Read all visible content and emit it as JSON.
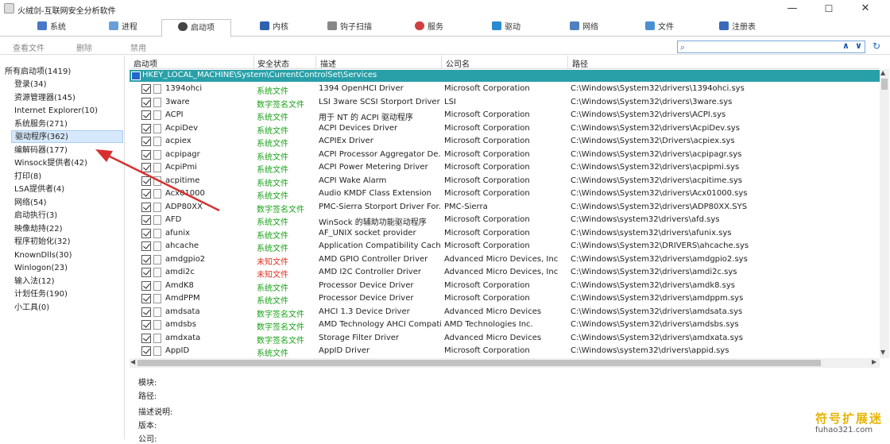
{
  "window": {
    "title": "火绒剑-互联网安全分析软件",
    "minimize": "—",
    "maximize": "☐",
    "close": "✕"
  },
  "tabs": [
    {
      "label": "系统",
      "icon": "system-icon",
      "color": "#4a78c8"
    },
    {
      "label": "进程",
      "icon": "process-icon",
      "color": "#6aa0d8"
    },
    {
      "label": "启动项",
      "icon": "startup-icon",
      "color": "#444444"
    },
    {
      "label": "内核",
      "icon": "kernel-icon",
      "color": "#3060b0"
    },
    {
      "label": "钩子扫描",
      "icon": "hook-scan-icon",
      "color": "#888888"
    },
    {
      "label": "服务",
      "icon": "service-icon",
      "color": "#d04040"
    },
    {
      "label": "驱动",
      "icon": "driver-icon",
      "color": "#2a8ad0"
    },
    {
      "label": "网络",
      "icon": "network-icon",
      "color": "#5080c0"
    },
    {
      "label": "文件",
      "icon": "file-icon",
      "color": "#4a90d0"
    },
    {
      "label": "注册表",
      "icon": "registry-icon",
      "color": "#3a6ab8"
    }
  ],
  "toolbar": {
    "view_file": "查看文件",
    "delete": "删除",
    "disable": "禁用"
  },
  "search": {
    "value": "",
    "up": "∧",
    "down": "∨",
    "refresh": "↻"
  },
  "sidebar": {
    "items": [
      {
        "label": "所有启动项(1419)"
      },
      {
        "label": "登录(34)"
      },
      {
        "label": "资源管理器(145)"
      },
      {
        "label": "Internet Explorer(10)"
      },
      {
        "label": "系统服务(271)"
      },
      {
        "label": "驱动程序(362)"
      },
      {
        "label": "编解码器(177)"
      },
      {
        "label": "Winsock提供者(42)"
      },
      {
        "label": "打印(8)"
      },
      {
        "label": "LSA提供者(4)"
      },
      {
        "label": "网络(54)"
      },
      {
        "label": "启动执行(3)"
      },
      {
        "label": "映像劫持(22)"
      },
      {
        "label": "程序初始化(32)"
      },
      {
        "label": "KnownDlls(30)"
      },
      {
        "label": "Winlogon(23)"
      },
      {
        "label": "输入法(12)"
      },
      {
        "label": "计划任务(190)"
      },
      {
        "label": "小工具(0)"
      }
    ]
  },
  "table": {
    "columns": [
      "启动项",
      "安全状态",
      "描述",
      "公司名",
      "路径"
    ],
    "group": "HKEY_LOCAL_MACHINE\\System\\CurrentControlSet\\Services",
    "rows": [
      {
        "name": "1394ohci",
        "sec": "系统文件",
        "st": "sys",
        "desc": "1394 OpenHCI Driver",
        "co": "Microsoft Corporation",
        "path": "C:\\Windows\\System32\\drivers\\1394ohci.sys"
      },
      {
        "name": "3ware",
        "sec": "数字签名文件",
        "st": "sig",
        "desc": "LSI 3ware SCSI Storport Driver",
        "co": "LSI",
        "path": "C:\\Windows\\System32\\drivers\\3ware.sys"
      },
      {
        "name": "ACPI",
        "sec": "系统文件",
        "st": "sys",
        "desc": "用于 NT 的 ACPI 驱动程序",
        "co": "Microsoft Corporation",
        "path": "C:\\Windows\\System32\\drivers\\ACPI.sys"
      },
      {
        "name": "AcpiDev",
        "sec": "系统文件",
        "st": "sys",
        "desc": "ACPI Devices Driver",
        "co": "Microsoft Corporation",
        "path": "C:\\Windows\\System32\\drivers\\AcpiDev.sys"
      },
      {
        "name": "acpiex",
        "sec": "系统文件",
        "st": "sys",
        "desc": "ACPIEx Driver",
        "co": "Microsoft Corporation",
        "path": "C:\\Windows\\System32\\Drivers\\acpiex.sys"
      },
      {
        "name": "acpipagr",
        "sec": "系统文件",
        "st": "sys",
        "desc": "ACPI Processor Aggregator De...",
        "co": "Microsoft Corporation",
        "path": "C:\\Windows\\System32\\drivers\\acpipagr.sys"
      },
      {
        "name": "AcpiPmi",
        "sec": "系统文件",
        "st": "sys",
        "desc": "ACPI Power Metering Driver",
        "co": "Microsoft Corporation",
        "path": "C:\\Windows\\System32\\drivers\\acpipmi.sys"
      },
      {
        "name": "acpitime",
        "sec": "系统文件",
        "st": "sys",
        "desc": "ACPI Wake Alarm",
        "co": "Microsoft Corporation",
        "path": "C:\\Windows\\System32\\drivers\\acpitime.sys"
      },
      {
        "name": "Acx01000",
        "sec": "系统文件",
        "st": "sys",
        "desc": "Audio KMDF Class Extension",
        "co": "Microsoft Corporation",
        "path": "C:\\Windows\\System32\\drivers\\Acx01000.sys"
      },
      {
        "name": "ADP80XX",
        "sec": "数字签名文件",
        "st": "sig",
        "desc": "PMC-Sierra Storport  Driver For...",
        "co": "PMC-Sierra",
        "path": "C:\\Windows\\System32\\drivers\\ADP80XX.SYS"
      },
      {
        "name": "AFD",
        "sec": "系统文件",
        "st": "sys",
        "desc": "WinSock 的辅助功能驱动程序",
        "co": "Microsoft Corporation",
        "path": "C:\\Windows\\system32\\drivers\\afd.sys"
      },
      {
        "name": "afunix",
        "sec": "系统文件",
        "st": "sys",
        "desc": "AF_UNIX socket provider",
        "co": "Microsoft Corporation",
        "path": "C:\\Windows\\system32\\drivers\\afunix.sys"
      },
      {
        "name": "ahcache",
        "sec": "系统文件",
        "st": "sys",
        "desc": "Application Compatibility Cache",
        "co": "Microsoft Corporation",
        "path": "C:\\Windows\\System32\\DRIVERS\\ahcache.sys"
      },
      {
        "name": "amdgpio2",
        "sec": "未知文件",
        "st": "unk",
        "desc": "AMD GPIO Controller Driver",
        "co": "Advanced Micro Devices, Inc",
        "path": "C:\\Windows\\System32\\drivers\\amdgpio2.sys"
      },
      {
        "name": "amdi2c",
        "sec": "未知文件",
        "st": "unk",
        "desc": "AMD I2C Controller Driver",
        "co": "Advanced Micro Devices, Inc",
        "path": "C:\\Windows\\System32\\drivers\\amdi2c.sys"
      },
      {
        "name": "AmdK8",
        "sec": "系统文件",
        "st": "sys",
        "desc": "Processor Device Driver",
        "co": "Microsoft Corporation",
        "path": "C:\\Windows\\System32\\drivers\\amdk8.sys"
      },
      {
        "name": "AmdPPM",
        "sec": "系统文件",
        "st": "sys",
        "desc": "Processor Device Driver",
        "co": "Microsoft Corporation",
        "path": "C:\\Windows\\System32\\drivers\\amdppm.sys"
      },
      {
        "name": "amdsata",
        "sec": "数字签名文件",
        "st": "sig",
        "desc": "AHCI 1.3 Device Driver",
        "co": "Advanced Micro Devices",
        "path": "C:\\Windows\\System32\\drivers\\amdsata.sys"
      },
      {
        "name": "amdsbs",
        "sec": "数字签名文件",
        "st": "sig",
        "desc": "AMD Technology AHCI Compati...",
        "co": "AMD Technologies Inc.",
        "path": "C:\\Windows\\System32\\drivers\\amdsbs.sys"
      },
      {
        "name": "amdxata",
        "sec": "数字签名文件",
        "st": "sig",
        "desc": "Storage Filter Driver",
        "co": "Advanced Micro Devices",
        "path": "C:\\Windows\\System32\\drivers\\amdxata.sys"
      },
      {
        "name": "AppID",
        "sec": "系统文件",
        "st": "sys",
        "desc": "AppID Driver",
        "co": "Microsoft Corporation",
        "path": "C:\\Windows\\system32\\drivers\\appid.sys"
      }
    ]
  },
  "details": {
    "module": "模块:",
    "path": "路径:",
    "description": "描述说明:",
    "version": "版本:",
    "company": "公司:"
  },
  "watermark": {
    "cn": "符号扩展迷",
    "en": "fuhao321.com"
  },
  "colors": {
    "accent": "#29a0a8",
    "system_file": "#1aa21a",
    "signed_file": "#1aa21a",
    "unknown_file": "#e03020",
    "selection": "#d6e8fb",
    "annotation_arrow": "#d83030"
  }
}
